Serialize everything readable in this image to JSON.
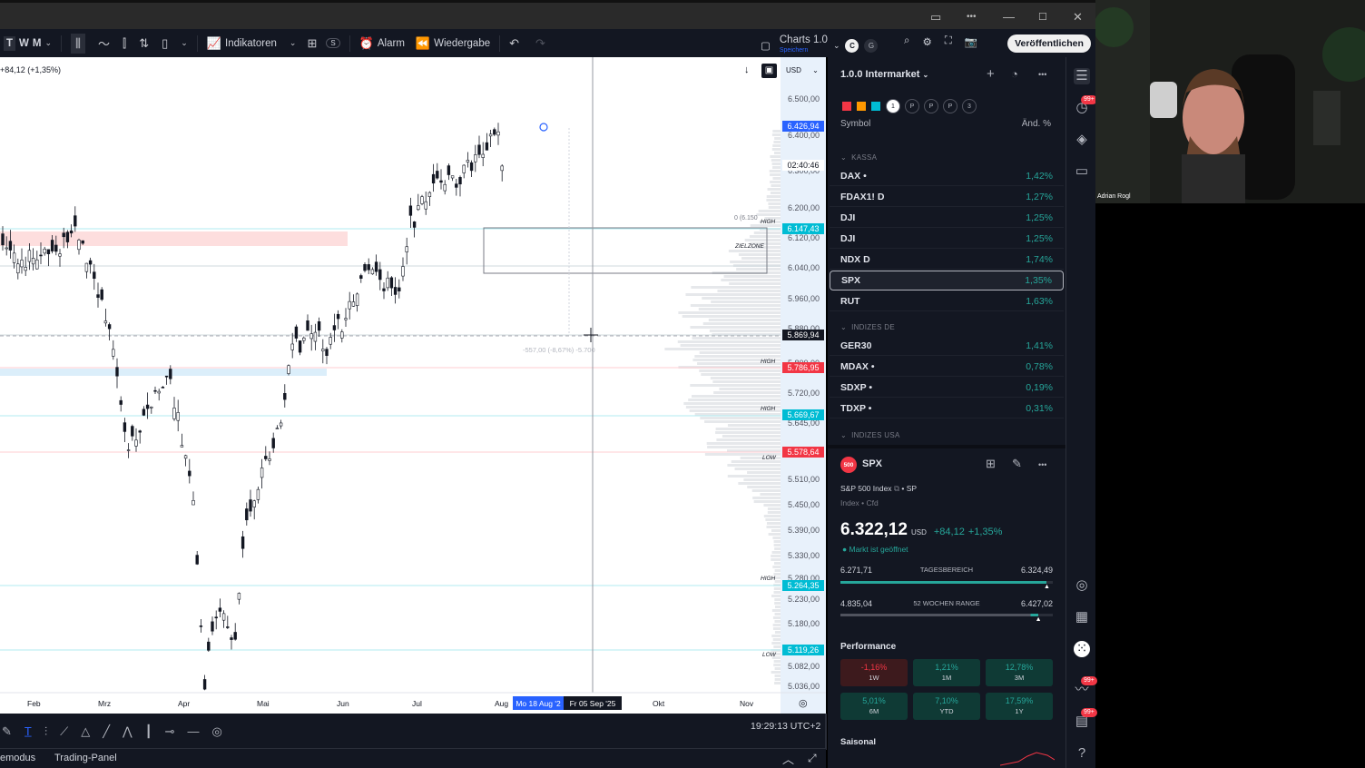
{
  "window": {
    "minimize": "—",
    "maximize": "☐",
    "close": "✕"
  },
  "toolbar": {
    "tf_t": "T",
    "tf_w": "W",
    "tf_m": "M",
    "indicators_label": "Indikatoren",
    "s_badge": "S",
    "alarm_label": "Alarm",
    "replay_label": "Wiedergabe",
    "layout_name": "Charts 1.0",
    "layout_sub": "Speichern",
    "c_badge": "C",
    "g_badge": "G",
    "publish_label": "Veröffentlichen"
  },
  "chart": {
    "ohlc_text": "+84,12 (+1,35%)",
    "currency": "USD",
    "price_axis": [
      "6.500,00",
      "6.400,00",
      "6.300,00",
      "6.200,00",
      "6.120,00",
      "6.040,00",
      "5.960,00",
      "5.880,00",
      "5.800,00",
      "5.720,00",
      "5.645,00",
      "5.570,00",
      "5.510,00",
      "5.450,00",
      "5.390,00",
      "5.330,00",
      "5.280,00",
      "5.230,00",
      "5.180,00",
      "5.120,00",
      "5.082,00",
      "5.036,00"
    ],
    "tags": [
      {
        "label": "6.426,94",
        "color": "#2962ff"
      },
      {
        "label": "02:40:46",
        "color": "#ffffff"
      },
      {
        "label": "6.147,43",
        "color": "#00bcd4"
      },
      {
        "label": "5.869,94",
        "color": "#131722"
      },
      {
        "label": "5.786,95",
        "color": "#f23645"
      },
      {
        "label": "5.669,67",
        "color": "#00bcd4"
      },
      {
        "label": "5.578,64",
        "color": "#f23645"
      },
      {
        "label": "5.264,35",
        "color": "#00bcd4"
      },
      {
        "label": "5.119,26",
        "color": "#00bcd4"
      }
    ],
    "level_labels": [
      "HIGH",
      "ZIELZONE",
      "HIGH",
      "HIGH",
      "LOW",
      "HIGH",
      "LOW"
    ],
    "fib_label": "0 (6.150",
    "measure_label": "-557,00 (-8,67%) -5.700",
    "time_axis": [
      "Feb",
      "Mrz",
      "Apr",
      "Mai",
      "Jun",
      "Jul",
      "Aug",
      "Okt",
      "Nov"
    ],
    "date_chip_1": "Mo 18 Aug '2",
    "date_chip_2": "Fr 05 Sep '25"
  },
  "bottom": {
    "clock": "19:29:13 UTC+2",
    "tab_1": "emodus",
    "tab_2": "Trading-Panel"
  },
  "watchlist": {
    "title": "1.0.0 Intermarket",
    "flags": [
      "1",
      "P",
      "P",
      "P",
      "3"
    ],
    "col_symbol": "Symbol",
    "col_change": "Änd. %",
    "sections": [
      "KASSA",
      "INDIZES DE",
      "INDIZES USA"
    ],
    "kassa": [
      {
        "symbol": "DAX •",
        "change": "1,42%"
      },
      {
        "symbol": "FDAX1! D",
        "change": "1,27%"
      },
      {
        "symbol": "DJI",
        "change": "1,25%"
      },
      {
        "symbol": "DJI",
        "change": "1,25%"
      },
      {
        "symbol": "NDX D",
        "change": "1,74%"
      },
      {
        "symbol": "SPX",
        "change": "1,35%"
      },
      {
        "symbol": "RUT",
        "change": "1,63%"
      }
    ],
    "indizes_de": [
      {
        "symbol": "GER30",
        "change": "1,41%"
      },
      {
        "symbol": "MDAX •",
        "change": "0,78%"
      },
      {
        "symbol": "SDXP •",
        "change": "0,19%"
      },
      {
        "symbol": "TDXP •",
        "change": "0,31%"
      }
    ]
  },
  "details": {
    "logo": "500",
    "symbol": "SPX",
    "name": "S&P 500 Index",
    "exchange": "SP",
    "type": "Index • Cfd",
    "price": "6.322,12",
    "currency": "USD",
    "change": "+84,12",
    "change_pct": "+1,35%",
    "market_status": "Markt ist geöffnet",
    "day_low": "6.271,71",
    "day_range_label": "TAGESBEREICH",
    "day_high": "6.324,49",
    "day_range_position": 0.97,
    "week_low": "4.835,04",
    "week_range_label": "52 WOCHEN RANGE",
    "week_high": "6.427,02",
    "week_range_position": 0.93,
    "performance_title": "Performance",
    "performance": [
      {
        "value": "-1,16%",
        "period": "1W",
        "positive": false
      },
      {
        "value": "1,21%",
        "period": "1M",
        "positive": true
      },
      {
        "value": "12,78%",
        "period": "3M",
        "positive": true
      },
      {
        "value": "5,01%",
        "period": "6M",
        "positive": true
      },
      {
        "value": "7,10%",
        "period": "YTD",
        "positive": true
      },
      {
        "value": "17,59%",
        "period": "1Y",
        "positive": true
      }
    ],
    "seasonal_title": "Saisonal"
  },
  "rail": {
    "badge_1": "99+",
    "badge_2": "99+",
    "badge_3": "99+"
  },
  "webcam": {
    "name": "Adrian Rogl"
  }
}
